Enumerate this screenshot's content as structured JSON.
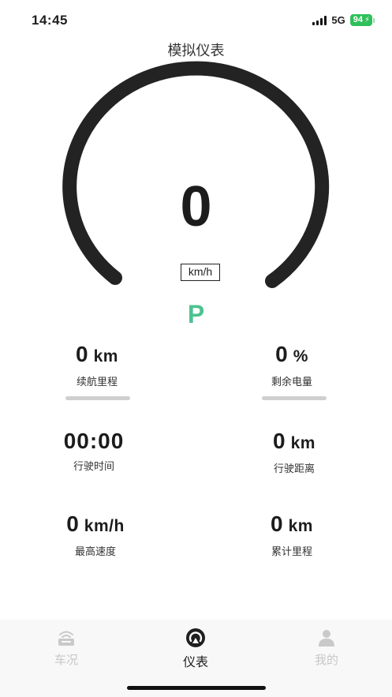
{
  "status_bar": {
    "time": "14:45",
    "network": "5G",
    "battery": "94",
    "battery_color": "#2ec05a"
  },
  "header": {
    "title": "模拟仪表"
  },
  "dashboard": {
    "speed": "0",
    "speed_unit": "km/h",
    "gear": "P",
    "gear_color": "#4cc38f"
  },
  "stats": {
    "range": {
      "value": "0",
      "unit": "km",
      "label": "续航里程"
    },
    "battery_left": {
      "value": "0",
      "unit": "%",
      "label": "剩余电量"
    },
    "drive_time": {
      "value": "00:00",
      "label": "行驶时间"
    },
    "drive_distance": {
      "value": "0",
      "unit": "km",
      "label": "行驶距离"
    },
    "max_speed": {
      "value": "0",
      "unit": "km/h",
      "label": "最高速度"
    },
    "total_mileage": {
      "value": "0",
      "unit": "km",
      "label": "累计里程"
    }
  },
  "tabs": [
    {
      "label": "车况",
      "icon": "car-status-icon",
      "active": false
    },
    {
      "label": "仪表",
      "icon": "dashboard-icon",
      "active": true
    },
    {
      "label": "我的",
      "icon": "user-icon",
      "active": false
    }
  ]
}
